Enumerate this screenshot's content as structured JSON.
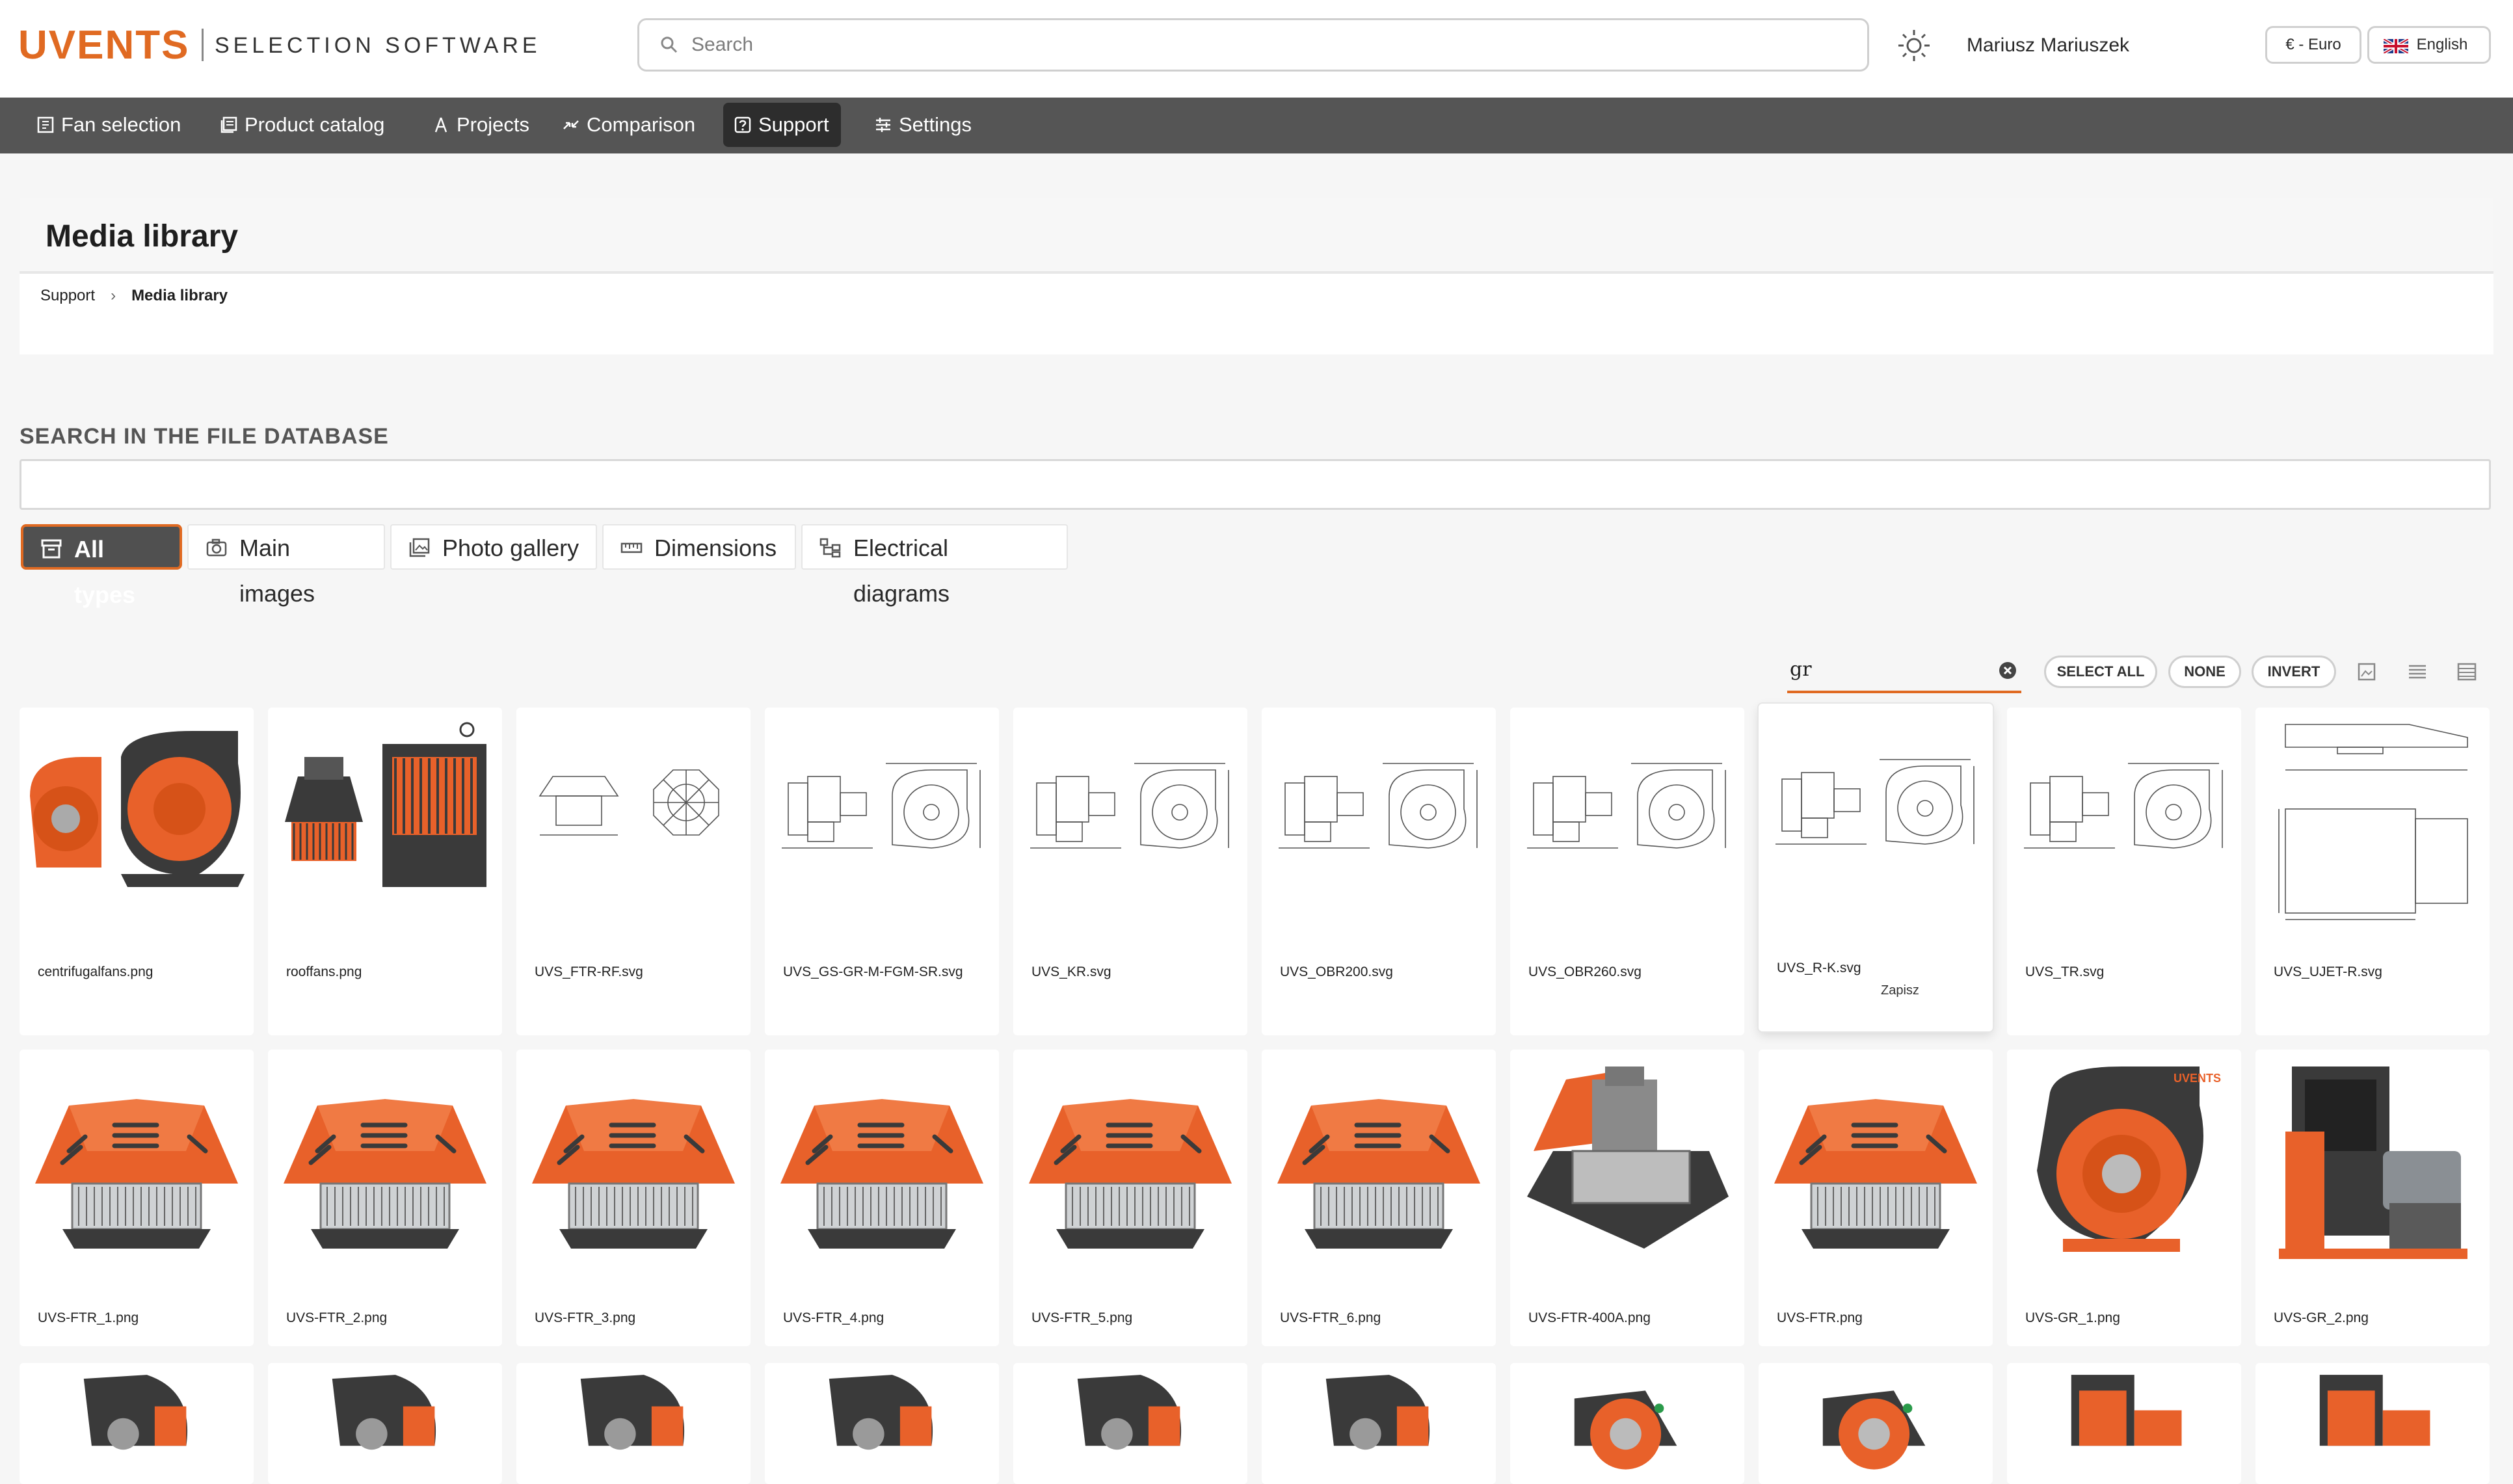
{
  "app": {
    "brand": "UVENTS",
    "subtitle": "SELECTION SOFTWARE",
    "search_placeholder": "Search",
    "user_name": "Mariusz Mariuszek",
    "currency": "€ - Euro",
    "language": "English",
    "accent_color": "#e06a22"
  },
  "nav": [
    {
      "label": "Fan selection",
      "icon": "fan-selection-icon"
    },
    {
      "label": "Product catalog",
      "icon": "catalog-icon"
    },
    {
      "label": "Projects",
      "icon": "projects-icon"
    },
    {
      "label": "Comparison",
      "icon": "comparison-icon"
    },
    {
      "label": "Support",
      "icon": "support-icon",
      "active": true
    },
    {
      "label": "Settings",
      "icon": "settings-icon"
    }
  ],
  "page": {
    "title": "Media library",
    "breadcrumb": [
      "Support",
      "Media library"
    ]
  },
  "search_db": {
    "label": "SEARCH IN THE FILE DATABASE",
    "value": ""
  },
  "filters": [
    {
      "label": "All types",
      "active": true
    },
    {
      "label": "Main images"
    },
    {
      "label": "Photo gallery"
    },
    {
      "label": "Dimensions"
    },
    {
      "label": "Electrical diagrams"
    }
  ],
  "toolbar": {
    "filter_value": "gr",
    "select_all": "SELECT ALL",
    "none": "NONE",
    "invert": "INVERT"
  },
  "grid": {
    "hover_tip": "Zapisz",
    "row1": [
      {
        "name": "centrifugalfans.png",
        "kind": "photo-centrifugal-pair"
      },
      {
        "name": "rooffans.png",
        "kind": "photo-roof-pair"
      },
      {
        "name": "UVS_FTR-RF.svg",
        "kind": "drawing-roof"
      },
      {
        "name": "UVS_GS-GR-M-FGM-SR.svg",
        "kind": "drawing-centrifugal"
      },
      {
        "name": "UVS_KR.svg",
        "kind": "drawing-centrifugal"
      },
      {
        "name": "UVS_OBR200.svg",
        "kind": "drawing-centrifugal"
      },
      {
        "name": "UVS_OBR260.svg",
        "kind": "drawing-centrifugal"
      },
      {
        "name": "UVS_R-K.svg",
        "kind": "drawing-centrifugal"
      },
      {
        "name": "UVS_TR.svg",
        "kind": "drawing-centrifugal"
      },
      {
        "name": "UVS_UJET-R.svg",
        "kind": "drawing-jet"
      }
    ],
    "row2": [
      {
        "name": "UVS-FTR_1.png",
        "kind": "photo-roof-fan"
      },
      {
        "name": "UVS-FTR_2.png",
        "kind": "photo-roof-fan"
      },
      {
        "name": "UVS-FTR_3.png",
        "kind": "photo-roof-fan"
      },
      {
        "name": "UVS-FTR_4.png",
        "kind": "photo-roof-fan"
      },
      {
        "name": "UVS-FTR_5.png",
        "kind": "photo-roof-fan"
      },
      {
        "name": "UVS-FTR_6.png",
        "kind": "photo-roof-fan"
      },
      {
        "name": "UVS-FTR-400A.png",
        "kind": "photo-roof-open"
      },
      {
        "name": "UVS-FTR.png",
        "kind": "photo-roof-fan"
      },
      {
        "name": "UVS-GR_1.png",
        "kind": "photo-centrifugal"
      },
      {
        "name": "UVS-GR_2.png",
        "kind": "photo-centrifugal-motor"
      }
    ],
    "row3_kinds": [
      "photo-dark-fan",
      "photo-dark-fan",
      "photo-dark-fan",
      "photo-dark-fan",
      "photo-dark-fan",
      "photo-dark-fan",
      "photo-orange-fan",
      "photo-orange-fan",
      "photo-orange-box",
      "photo-orange-box"
    ]
  }
}
